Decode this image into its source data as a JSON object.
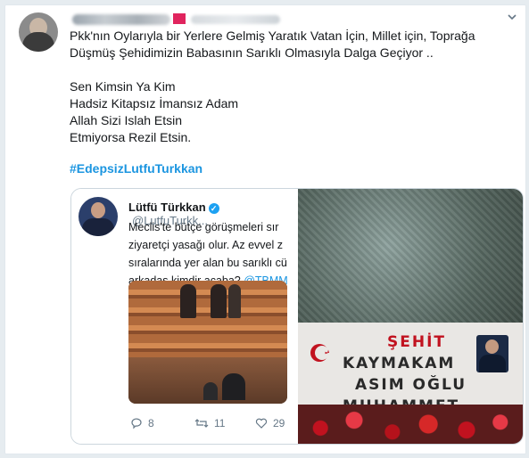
{
  "tweet": {
    "text_lines": [
      "Pkk'nın Oylarıyla bir Yerlere Gelmiş Yaratık Vatan İçin, Millet için,  Toprağa",
      "Düşmüş Şehidimizin Babasının Sarıklı Olmasıyla Dalga Geçiyor .."
    ],
    "poem_lines": [
      "Sen Kimsin Ya Kim",
      "Hadsiz Kitapsız İmansız Adam",
      "Allah Sizi Islah Etsin",
      "Etmiyorsa Rezil Etsin."
    ],
    "hashtag": "#EdepsizLutfuTurkkan"
  },
  "quoted_tweet": {
    "name": "Lütfü Türkkan",
    "handle": "@LutfuTurkk...",
    "text_lines": [
      "Meclis'te bütçe görüşmeleri sır",
      "ziyaretçi yasağı olur. Az evvel z",
      "sıralarında yer alan bu sarıklı cü",
      "arkadaş kimdir acaba? "
    ],
    "mention": "@TBMM",
    "reply_count": "8",
    "retweet_count": "11",
    "like_count": "29"
  },
  "plaque": {
    "line1": "ŞEHİT",
    "line2": "KAYMAKAM",
    "line3": "ASIM OĞLU",
    "line4": "MUHAMMET FATİH"
  },
  "colors": {
    "link": "#1b95e0",
    "verified": "#1da1f2",
    "martyr_red": "#c1121f"
  }
}
